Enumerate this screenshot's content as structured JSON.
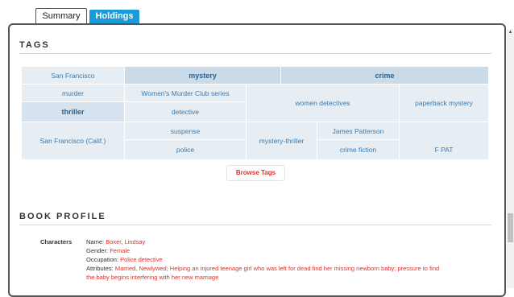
{
  "tabs": {
    "summary": "Summary",
    "holdings": "Holdings"
  },
  "tags": {
    "heading": "TAGS",
    "items": [
      "San Francisco",
      "mystery",
      "crime",
      "murder",
      "Women's Murder Club series",
      "women detectives",
      "paperback mystery",
      "thriller",
      "detective",
      "San Francisco (Calif.)",
      "suspense",
      "mystery-thriller",
      "James Patterson",
      "police",
      "crime fiction",
      "F PAT"
    ],
    "browse_label": "Browse Tags"
  },
  "profile": {
    "heading": "BOOK PROFILE",
    "characters_label": "Characters",
    "lines": [
      {
        "label": "Name: ",
        "value": "Boxer, Lindsay"
      },
      {
        "label": "Gender: ",
        "value": "Female"
      },
      {
        "label": "Occupation: ",
        "value": "Police detective"
      },
      {
        "label": "Attributes: ",
        "value": "Married, Newlywed; Helping an injured teenage girl who was left for dead find her missing newborn baby; pressure to find"
      }
    ],
    "continuation": "the baby begins interfering with her new marriage"
  },
  "colors": {
    "accent": "#1a9ad6",
    "link": "#3a7ab0",
    "highlight": "#e0302a"
  },
  "icons": {
    "scroll_up": "triangle-up-icon"
  }
}
